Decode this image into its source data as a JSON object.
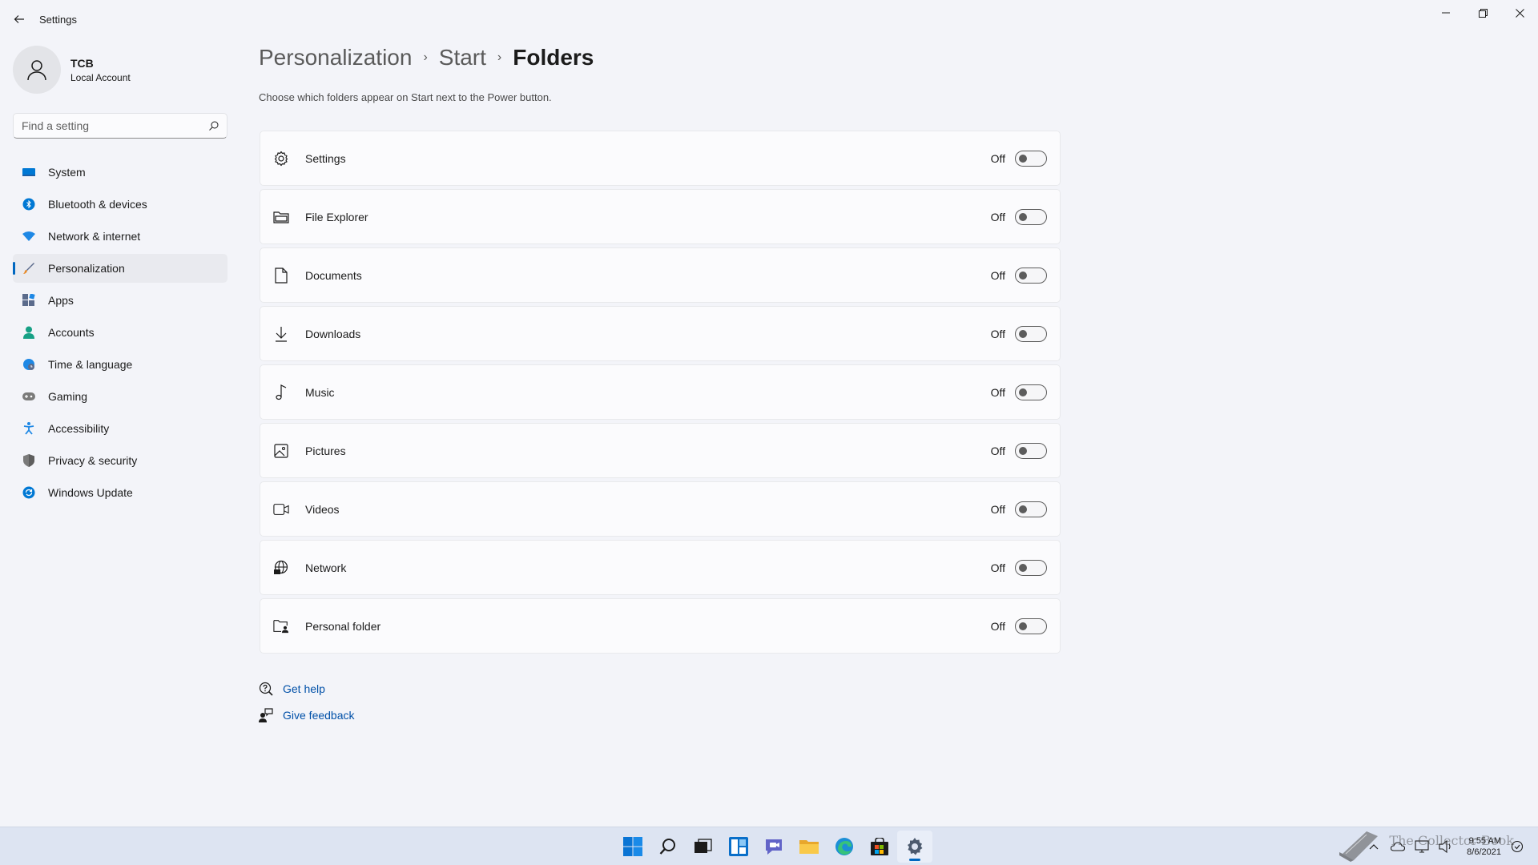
{
  "window": {
    "title": "Settings"
  },
  "profile": {
    "name": "TCB",
    "account_type": "Local Account"
  },
  "search": {
    "placeholder": "Find a setting"
  },
  "nav": {
    "items": [
      {
        "label": "System",
        "icon": "monitor-icon",
        "color": "#0078d4"
      },
      {
        "label": "Bluetooth & devices",
        "icon": "bluetooth-icon",
        "color": "#0078d4"
      },
      {
        "label": "Network & internet",
        "icon": "wifi-icon",
        "color": "#1e88e5"
      },
      {
        "label": "Personalization",
        "icon": "brush-icon",
        "color": "#e88b2a",
        "active": true
      },
      {
        "label": "Apps",
        "icon": "apps-icon",
        "color": "#5b6b8c"
      },
      {
        "label": "Accounts",
        "icon": "person-icon",
        "color": "#16a085"
      },
      {
        "label": "Time & language",
        "icon": "globe-clock-icon",
        "color": "#1e88e5"
      },
      {
        "label": "Gaming",
        "icon": "gamepad-icon",
        "color": "#7a7a7a"
      },
      {
        "label": "Accessibility",
        "icon": "accessibility-icon",
        "color": "#1e88e5"
      },
      {
        "label": "Privacy & security",
        "icon": "shield-icon",
        "color": "#7a7a7a"
      },
      {
        "label": "Windows Update",
        "icon": "update-icon",
        "color": "#0078d4"
      }
    ]
  },
  "breadcrumb": {
    "items": [
      "Personalization",
      "Start"
    ],
    "current": "Folders"
  },
  "description": "Choose which folders appear on Start next to the Power button.",
  "folders": [
    {
      "label": "Settings",
      "icon": "gear-icon",
      "state": "Off"
    },
    {
      "label": "File Explorer",
      "icon": "folder-icon",
      "state": "Off"
    },
    {
      "label": "Documents",
      "icon": "document-icon",
      "state": "Off"
    },
    {
      "label": "Downloads",
      "icon": "download-icon",
      "state": "Off"
    },
    {
      "label": "Music",
      "icon": "music-note-icon",
      "state": "Off"
    },
    {
      "label": "Pictures",
      "icon": "picture-icon",
      "state": "Off"
    },
    {
      "label": "Videos",
      "icon": "video-camera-icon",
      "state": "Off"
    },
    {
      "label": "Network",
      "icon": "network-globe-icon",
      "state": "Off"
    },
    {
      "label": "Personal folder",
      "icon": "personal-folder-icon",
      "state": "Off"
    }
  ],
  "help": {
    "get_help": "Get help",
    "give_feedback": "Give feedback"
  },
  "taskbar": {
    "apps": [
      "start-icon",
      "search-icon",
      "task-view-icon",
      "widgets-icon",
      "chat-icon",
      "file-explorer-icon",
      "edge-icon",
      "store-icon",
      "settings-icon"
    ],
    "active_app": "settings-icon"
  },
  "tray": {
    "time": "9:55 AM",
    "date": "8/6/2021"
  },
  "watermark": "The Collector Book",
  "colors": {
    "accent": "#0067c0",
    "background": "#f3f4f9",
    "card": "#fbfbfd"
  }
}
